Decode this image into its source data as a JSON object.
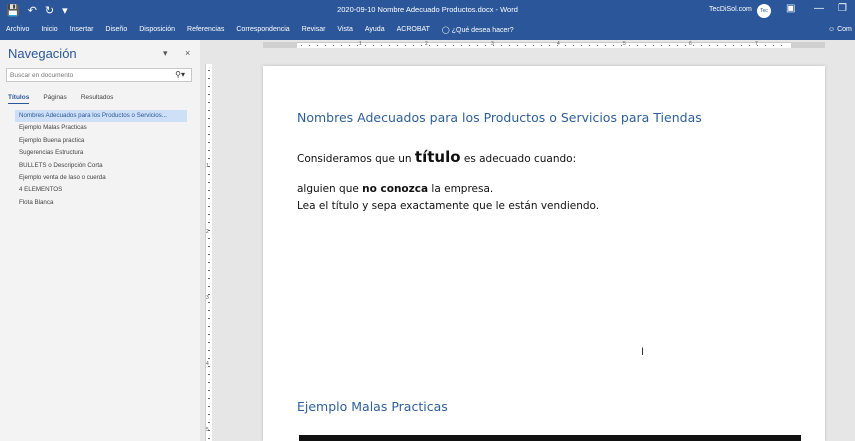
{
  "titlebar": {
    "title": "2020-09-10 Nombre Adecuado Productos.docx  -  Word",
    "user": "TecDiSol.com",
    "avatar": "Tec",
    "qat_icons": [
      "save-icon",
      "undo-icon",
      "redo-icon",
      "customize-icon"
    ]
  },
  "ribbon": {
    "tabs": [
      "Archivo",
      "Inicio",
      "Insertar",
      "Diseño",
      "Disposición",
      "Referencias",
      "Correspondencia",
      "Revisar",
      "Vista",
      "Ayuda",
      "ACROBAT"
    ],
    "tell_me": "¿Qué desea hacer?",
    "share": "Com"
  },
  "nav": {
    "title": "Navegación",
    "search_placeholder": "Buscar en documento",
    "tabs": [
      "Títulos",
      "Páginas",
      "Resultados"
    ],
    "headings": [
      "Nombres Adecuados para los Productos o Servicios...",
      "Ejemplo Malas Practicas",
      "Ejemplo Buena practica",
      "Sugerencias Estructura",
      "BULLETS o Descripción Corta",
      "Ejemplo venta de laso o cuerda",
      "4 ELEMENTOS",
      "Flota Blanca"
    ]
  },
  "ruler": {
    "h_labels": [
      "1",
      "2",
      "3",
      "4",
      "5",
      "6",
      "7"
    ],
    "v_labels": [
      "1",
      "2",
      "3",
      "4",
      "5"
    ]
  },
  "document": {
    "heading1": "Nombres Adecuados para los Productos o Servicios para Tiendas",
    "para1_a": "Consideramos que un ",
    "para1_bold": "título",
    "para1_b": " es adecuado cuando:",
    "para2_a": "alguien que ",
    "para2_bold": "no conozca",
    "para2_b": " la empresa.",
    "para3": "Lea el título y sepa exactamente que le están vendiendo.",
    "heading2": "Ejemplo Malas Practicas"
  },
  "colors": {
    "word_blue": "#2b579a",
    "heading_blue": "#2e5f99"
  }
}
